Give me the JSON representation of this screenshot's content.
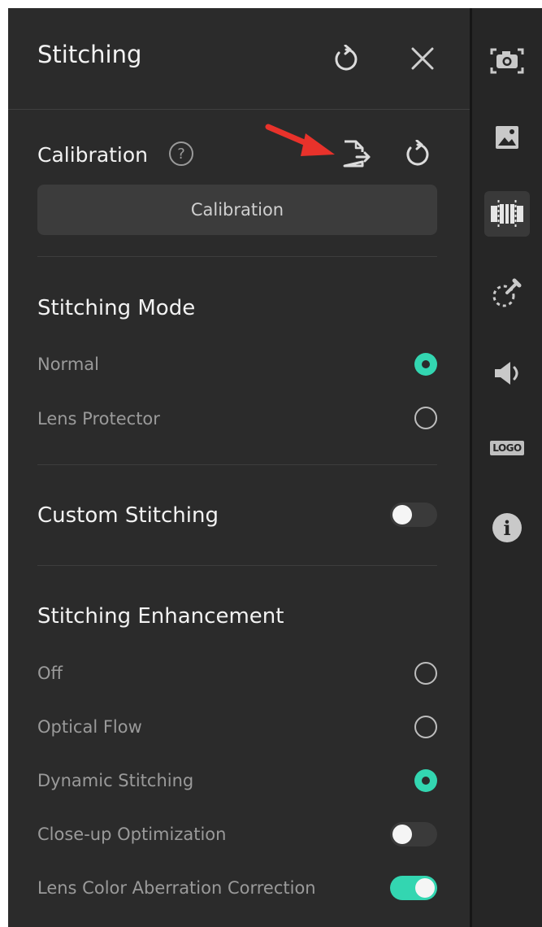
{
  "panel": {
    "title": "Stitching",
    "calibration": {
      "title": "Calibration",
      "help_glyph": "?",
      "button_label": "Calibration"
    },
    "stitching_mode": {
      "title": "Stitching Mode",
      "options": [
        {
          "label": "Normal",
          "selected": true
        },
        {
          "label": "Lens Protector",
          "selected": false
        }
      ]
    },
    "custom_stitching": {
      "title": "Custom Stitching",
      "enabled": false
    },
    "enhancement": {
      "title": "Stitching Enhancement",
      "options": [
        {
          "label": "Off",
          "selected": false
        },
        {
          "label": "Optical Flow",
          "selected": false
        },
        {
          "label": "Dynamic Stitching",
          "selected": true
        }
      ],
      "close_up": {
        "label": "Close-up Optimization",
        "enabled": false
      },
      "aberration": {
        "label": "Lens Color Aberration Correction",
        "enabled": true
      }
    }
  },
  "rail": {
    "items": [
      {
        "icon": "camera-icon",
        "active": false
      },
      {
        "icon": "image-icon",
        "active": false
      },
      {
        "icon": "stitching-icon",
        "active": true
      },
      {
        "icon": "dropper-icon",
        "active": false
      },
      {
        "icon": "speaker-icon",
        "active": false
      },
      {
        "icon": "logo-icon",
        "label": "LOGO",
        "active": false
      },
      {
        "icon": "info-icon",
        "label": "i",
        "active": false
      }
    ]
  },
  "colors": {
    "accent": "#33d6b1",
    "panel_bg": "#2b2b2b",
    "annotation_arrow": "#e8322b"
  }
}
